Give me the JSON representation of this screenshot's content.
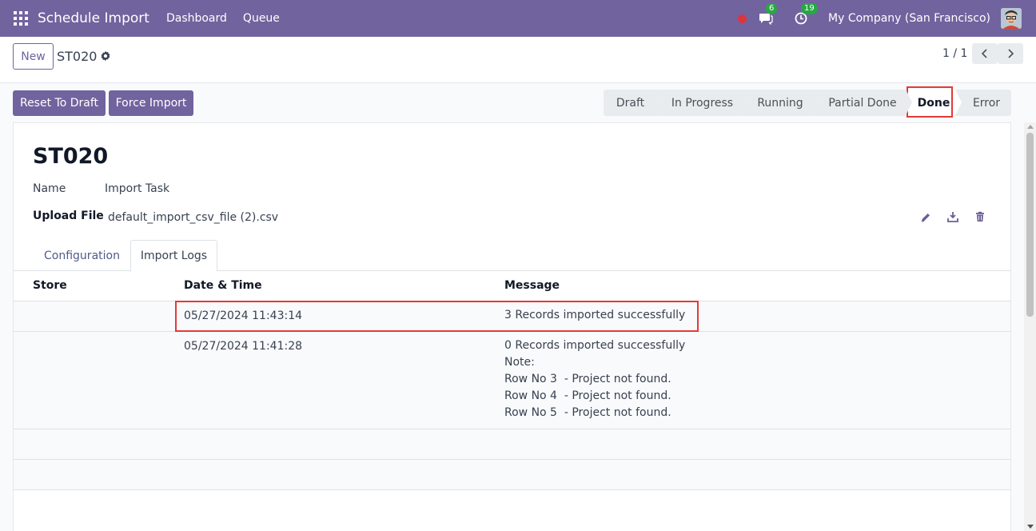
{
  "navbar": {
    "app_title": "Schedule Import",
    "links": [
      "Dashboard",
      "Queue"
    ],
    "messages_count": "6",
    "activities_count": "19",
    "company": "My Company (San Francisco)"
  },
  "control": {
    "new_label": "New",
    "breadcrumb": "ST020",
    "pager": "1 / 1"
  },
  "actions": {
    "reset_label": "Reset To Draft",
    "force_label": "Force Import"
  },
  "statusbar": {
    "stages": [
      "Draft",
      "In Progress",
      "Running",
      "Partial Done",
      "Done",
      "Error"
    ],
    "active": "Done"
  },
  "record": {
    "title": "ST020",
    "name_label": "Name",
    "name_value": "Import Task",
    "upload_label": "Upload File",
    "upload_value": "default_import_csv_file (2).csv"
  },
  "tabs": [
    "Configuration",
    "Import Logs"
  ],
  "table": {
    "headers": [
      "Store",
      "Date & Time",
      "Message"
    ],
    "rows": [
      {
        "store": "",
        "datetime": "05/27/2024 11:43:14",
        "message": [
          "3 Records imported successfully"
        ]
      },
      {
        "store": "",
        "datetime": "05/27/2024 11:41:28",
        "message": [
          "0 Records imported successfully",
          "Note:",
          "Row No 3  - Project not found.",
          "Row No 4  - Project not found.",
          "Row No 5  - Project not found."
        ]
      }
    ]
  },
  "colors": {
    "brand": "#71639e",
    "highlight": "#e53935",
    "badge": "#28a745"
  }
}
